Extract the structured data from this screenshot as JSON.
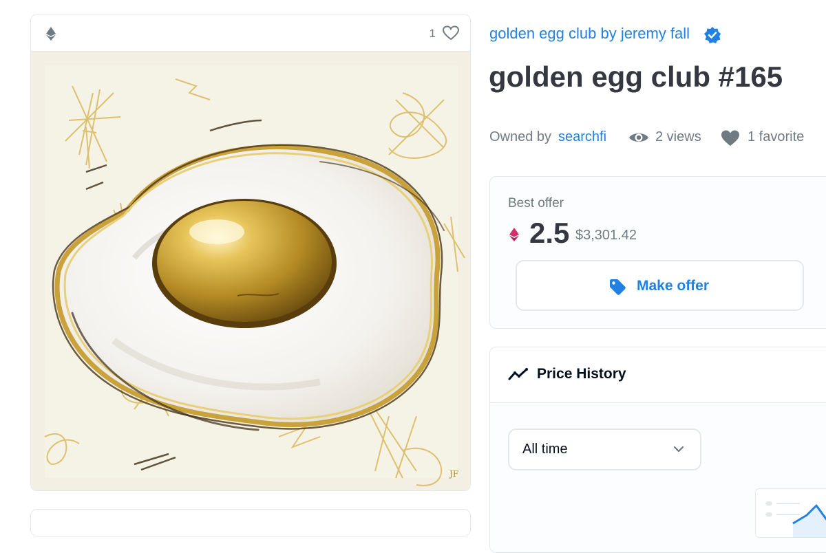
{
  "media": {
    "favorite_count": "1",
    "chain_icon": "ethereum-icon",
    "like_icon": "heart-outline-icon",
    "signature": "JF"
  },
  "collection": {
    "name": "golden egg club by jeremy fall",
    "verified_icon": "verified-badge-icon"
  },
  "item": {
    "title": "golden egg club #165"
  },
  "meta": {
    "owned_by_label": "Owned by",
    "owner": "searchfi",
    "views": "2 views",
    "favorites": "1 favorite"
  },
  "offer": {
    "label": "Best offer",
    "price": "2.5",
    "price_usd": "$3,301.42",
    "button_label": "Make offer"
  },
  "price_history": {
    "title": "Price History",
    "time_filter": "All time"
  },
  "colors": {
    "accent": "#2081e2",
    "text_primary": "#353840",
    "text_secondary": "#707a83",
    "border": "#e5e8eb",
    "eth_pink": "#d4306e"
  }
}
